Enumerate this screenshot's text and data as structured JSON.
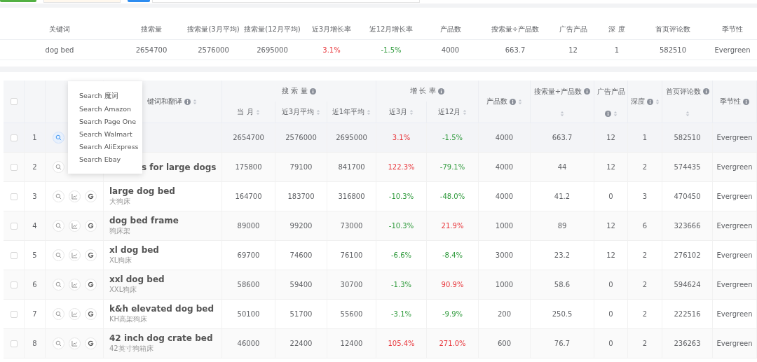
{
  "summary": {
    "columns": [
      "关键词",
      "搜索量",
      "搜索量(3月平均)",
      "搜索量(12月平均)",
      "近3月增长率",
      "近12月增长率",
      "产品数",
      "搜索量÷产品数",
      "广告产品",
      "深 度",
      "首页评论数",
      "季节性"
    ],
    "row": [
      {
        "kind": "plain",
        "text": "dog bed"
      },
      {
        "kind": "plain",
        "text": "2654700"
      },
      {
        "kind": "plain",
        "text": "2576000"
      },
      {
        "kind": "plain",
        "text": "2695000"
      },
      {
        "kind": "growth",
        "text": "3.1%",
        "rising": true
      },
      {
        "kind": "growth",
        "text": "-1.5%",
        "rising": false
      },
      {
        "kind": "plain",
        "text": "4000"
      },
      {
        "kind": "plain",
        "text": "663.7"
      },
      {
        "kind": "plain",
        "text": "12"
      },
      {
        "kind": "plain",
        "text": "1"
      },
      {
        "kind": "plain",
        "text": "582510"
      },
      {
        "kind": "plain",
        "text": "Evergreen"
      }
    ]
  },
  "table": {
    "select_all": {
      "checked": false
    },
    "columns": [
      {
        "kind": "actions"
      },
      {
        "kind": "leaf",
        "label": "键词和翻译",
        "info": true,
        "sortable": true
      },
      {
        "kind": "group",
        "label": "搜 索 量",
        "info": true,
        "children": [
          {
            "label": "当 月",
            "sortable": true
          },
          {
            "label": "近3月平均",
            "sortable": true
          },
          {
            "label": "近1年平均",
            "sortable": true
          }
        ]
      },
      {
        "kind": "group",
        "label": "增 长 率",
        "info": true,
        "children": [
          {
            "label": "近3月",
            "sortable": true
          },
          {
            "label": "近12月",
            "sortable": true
          }
        ]
      },
      {
        "kind": "leaf",
        "label": "产品数",
        "info": true,
        "sortable": true
      },
      {
        "kind": "leaf",
        "label": "搜索量÷产品数",
        "info": true,
        "sortable": true
      },
      {
        "kind": "leaf",
        "label": "广告产品",
        "info": true,
        "sortable": true
      },
      {
        "kind": "leaf",
        "label": "深度",
        "info": true,
        "sortable": true
      },
      {
        "kind": "leaf",
        "label": "首页评论数",
        "info": true,
        "sortable": true
      },
      {
        "kind": "leaf",
        "label": "季节性",
        "info": true
      }
    ],
    "rows": [
      {
        "index": "1",
        "checked": false,
        "highlighted": true,
        "covered": true,
        "values": [
          "2654700",
          "2576000",
          "2695000"
        ],
        "growth": [
          {
            "text": "3.1%",
            "rising": true
          },
          {
            "text": "-1.5%",
            "rising": false
          }
        ],
        "metrics": [
          "4000",
          "663.7",
          "12",
          "1",
          "582510",
          "Evergreen"
        ]
      },
      {
        "index": "2",
        "checked": false,
        "highlighted": false,
        "covered": true,
        "keyword": "s for large dogs",
        "values": [
          "175800",
          "79100",
          "841700"
        ],
        "growth": [
          {
            "text": "122.3%",
            "rising": true
          },
          {
            "text": "-79.1%",
            "rising": false
          }
        ],
        "metrics": [
          "4000",
          "44",
          "12",
          "2",
          "574435",
          "Evergreen"
        ]
      },
      {
        "index": "3",
        "checked": false,
        "highlighted": false,
        "covered": false,
        "keyword": "large dog bed",
        "translation": "大狗床",
        "values": [
          "164700",
          "183700",
          "316800"
        ],
        "growth": [
          {
            "text": "-10.3%",
            "rising": false
          },
          {
            "text": "-48.0%",
            "rising": false
          }
        ],
        "metrics": [
          "4000",
          "41.2",
          "0",
          "3",
          "470450",
          "Evergreen"
        ]
      },
      {
        "index": "4",
        "checked": false,
        "highlighted": false,
        "covered": false,
        "keyword": "dog bed frame",
        "translation": "狗床架",
        "values": [
          "89000",
          "99200",
          "73000"
        ],
        "growth": [
          {
            "text": "-10.3%",
            "rising": false
          },
          {
            "text": "21.9%",
            "rising": true
          }
        ],
        "metrics": [
          "1000",
          "89",
          "12",
          "6",
          "323666",
          "Evergreen"
        ]
      },
      {
        "index": "5",
        "checked": false,
        "highlighted": false,
        "covered": false,
        "keyword": "xl dog bed",
        "translation": "XL狗床",
        "values": [
          "69700",
          "74600",
          "76100"
        ],
        "growth": [
          {
            "text": "-6.6%",
            "rising": false
          },
          {
            "text": "-8.4%",
            "rising": false
          }
        ],
        "metrics": [
          "3000",
          "23.2",
          "12",
          "2",
          "276102",
          "Evergreen"
        ]
      },
      {
        "index": "6",
        "checked": false,
        "highlighted": false,
        "covered": false,
        "keyword": "xxl dog bed",
        "translation": "XXL狗床",
        "values": [
          "58600",
          "59400",
          "30700"
        ],
        "growth": [
          {
            "text": "-1.3%",
            "rising": false
          },
          {
            "text": "90.9%",
            "rising": true
          }
        ],
        "metrics": [
          "1000",
          "58.6",
          "0",
          "2",
          "594624",
          "Evergreen"
        ]
      },
      {
        "index": "7",
        "checked": false,
        "highlighted": false,
        "covered": false,
        "keyword": "k&h elevated dog bed",
        "translation": "KH高架狗床",
        "values": [
          "50100",
          "51700",
          "55600"
        ],
        "growth": [
          {
            "text": "-3.1%",
            "rising": false
          },
          {
            "text": "-9.9%",
            "rising": false
          }
        ],
        "metrics": [
          "200",
          "250.5",
          "0",
          "2",
          "222516",
          "Evergreen"
        ]
      },
      {
        "index": "8",
        "checked": false,
        "highlighted": false,
        "covered": false,
        "keyword": "42 inch dog crate bed",
        "translation": "42英寸狗箱床",
        "values": [
          "46000",
          "22400",
          "12400"
        ],
        "growth": [
          {
            "text": "105.4%",
            "rising": true
          },
          {
            "text": "271.0%",
            "rising": true
          }
        ],
        "metrics": [
          "600",
          "76.7",
          "0",
          "2",
          "236263",
          "Evergreen"
        ]
      }
    ]
  },
  "search_menu": {
    "items": [
      "Search 魔词",
      "Search Amazon",
      "Search Page One",
      "Search Walmart",
      "Search AliExpress",
      "Search Ebay"
    ]
  }
}
